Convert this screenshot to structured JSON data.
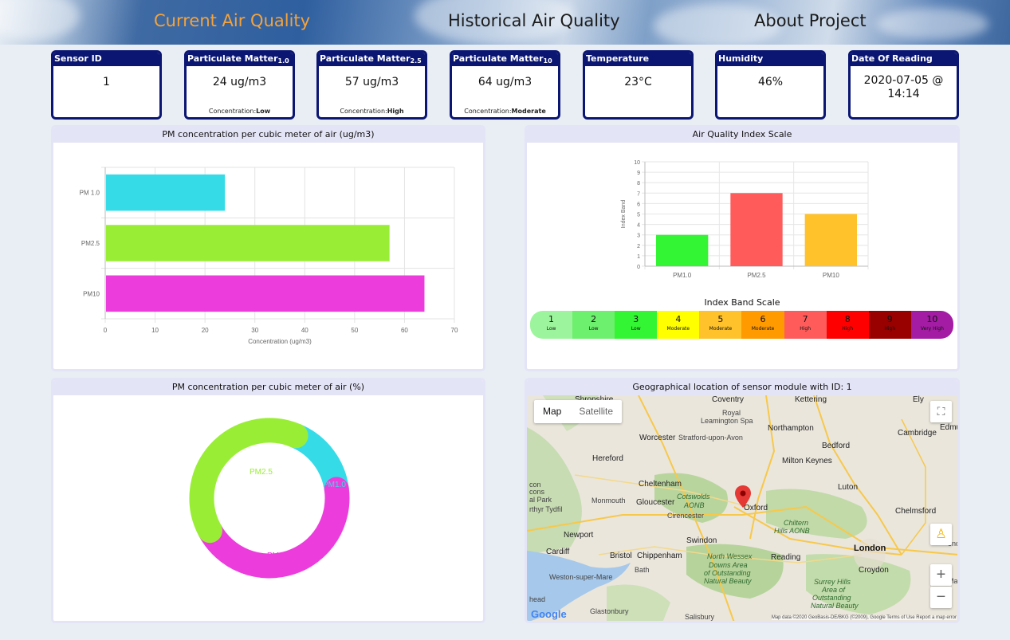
{
  "nav": {
    "items": [
      {
        "label": "Current Air Quality",
        "active": true
      },
      {
        "label": "Historical Air Quality",
        "active": false
      },
      {
        "label": "About Project",
        "active": false
      }
    ]
  },
  "cards": {
    "sensor": {
      "title": "Sensor ID",
      "value": "1"
    },
    "pm1": {
      "title": "Particulate Matter",
      "sub": "1.0",
      "value": "24 ug/m3",
      "conc_label": "Concentration:",
      "conc_value": "Low"
    },
    "pm25": {
      "title": "Particulate Matter",
      "sub": "2.5",
      "value": "57 ug/m3",
      "conc_label": "Concentration:",
      "conc_value": "High"
    },
    "pm10": {
      "title": "Particulate Matter",
      "sub": "10",
      "value": "64 ug/m3",
      "conc_label": "Concentration:",
      "conc_value": "Moderate"
    },
    "temp": {
      "title": "Temperature",
      "value": "23°C"
    },
    "humidity": {
      "title": "Humidity",
      "value": "46%"
    },
    "date": {
      "title": "Date Of Reading",
      "value_line1": "2020-07-05 @",
      "value_line2": "14:14"
    }
  },
  "panels": {
    "bar_title": "PM concentration per cubic meter of air (ug/m3)",
    "aqi_title": "Air Quality Index Scale",
    "donut_title": "PM concentration per cubic meter of air (%)",
    "map_title": "Geographical location of sensor module with ID: 1"
  },
  "chart_data": [
    {
      "type": "bar",
      "orientation": "horizontal",
      "categories": [
        "PM 1.0",
        "PM2.5",
        "PM10"
      ],
      "values": [
        24,
        57,
        64
      ],
      "colors": [
        "#36dbe8",
        "#99ee35",
        "#ec3ddc"
      ],
      "xlabel": "Concentration (ug/m3)",
      "xlim": [
        0,
        70
      ],
      "xticks": [
        0,
        10,
        20,
        30,
        40,
        50,
        60,
        70
      ],
      "grid": true
    },
    {
      "type": "bar",
      "categories": [
        "PM1.0",
        "PM2.5",
        "PM10"
      ],
      "values": [
        3,
        7,
        5
      ],
      "colors": [
        "#33f533",
        "#ff5b5b",
        "#ffc22b"
      ],
      "ylabel": "Index Band",
      "ylim": [
        0,
        10
      ],
      "yticks": [
        0,
        1,
        2,
        3,
        4,
        5,
        6,
        7,
        8,
        9,
        10
      ],
      "grid": true
    },
    {
      "type": "pie",
      "style": "donut",
      "categories": [
        "PM1.0",
        "PM2.5",
        "PM10."
      ],
      "values": [
        24,
        57,
        64
      ],
      "colors": [
        "#36dbe8",
        "#99ee35",
        "#ec3ddc"
      ]
    }
  ],
  "band_scale": {
    "title": "Index Band Scale",
    "bands": [
      {
        "n": "1",
        "label": "Low",
        "color": "#9cf59c"
      },
      {
        "n": "2",
        "label": "Low",
        "color": "#6df06d"
      },
      {
        "n": "3",
        "label": "Low",
        "color": "#33f533"
      },
      {
        "n": "4",
        "label": "Moderate",
        "color": "#ffff00"
      },
      {
        "n": "5",
        "label": "Moderate",
        "color": "#ffc22b"
      },
      {
        "n": "6",
        "label": "Moderate",
        "color": "#ff9a00"
      },
      {
        "n": "7",
        "label": "High",
        "color": "#ff5b5b"
      },
      {
        "n": "8",
        "label": "High",
        "color": "#ff0000"
      },
      {
        "n": "9",
        "label": "High",
        "color": "#990000"
      },
      {
        "n": "10",
        "label": "Very High",
        "color": "#a31ca3"
      }
    ]
  },
  "map": {
    "toggle_map": "Map",
    "toggle_satellite": "Satellite",
    "fullscreen_icon": "fullscreen-icon",
    "pegman_icon": "pegman-icon",
    "zoom_in": "+",
    "zoom_out": "−",
    "logo": "Google",
    "attribution": "Map data ©2020 GeoBasis-DE/BKG (©2009), Google   Terms of Use   Report a map error",
    "labels": [
      {
        "t": "Shropshire"
      },
      {
        "t": "Coventry"
      },
      {
        "t": "Kettering"
      },
      {
        "t": "Ely"
      },
      {
        "t": "Royal"
      },
      {
        "t": "Leamington Spa"
      },
      {
        "t": "Northampton"
      },
      {
        "t": "Cambridge"
      },
      {
        "t": "Worcester"
      },
      {
        "t": "Stratford-upon-Avon"
      },
      {
        "t": "Edmu"
      },
      {
        "t": "Bedford"
      },
      {
        "t": "Hereford"
      },
      {
        "t": "Milton Keynes"
      },
      {
        "t": "Cheltenham"
      },
      {
        "t": "Luton"
      },
      {
        "t": "Gloucester"
      },
      {
        "t": "Cotswolds"
      },
      {
        "t": "AONB"
      },
      {
        "t": "Oxford"
      },
      {
        "t": "Chelmsford"
      },
      {
        "t": "Monmouth"
      },
      {
        "t": "Cirencester"
      },
      {
        "t": "Chiltern"
      },
      {
        "t": "Hills AONB"
      },
      {
        "t": "Newport"
      },
      {
        "t": "Swindon"
      },
      {
        "t": "London"
      },
      {
        "t": "Cardiff"
      },
      {
        "t": "Bristol"
      },
      {
        "t": "Chippenham"
      },
      {
        "t": "North Wessex"
      },
      {
        "t": "Downs Area"
      },
      {
        "t": "of Outstanding"
      },
      {
        "t": "Natural Beauty"
      },
      {
        "t": "Reading"
      },
      {
        "t": "Bath"
      },
      {
        "t": "Croydon"
      },
      {
        "t": "Weston-super-Mare"
      },
      {
        "t": "Surrey Hills"
      },
      {
        "t": "Area of"
      },
      {
        "t": "Outstanding"
      },
      {
        "t": "Natural Beauty"
      },
      {
        "t": "Glastonbury"
      },
      {
        "t": "Salisbury"
      },
      {
        "t": "con"
      },
      {
        "t": "cons"
      },
      {
        "t": "al Park"
      },
      {
        "t": "rthyr Tydfil"
      },
      {
        "t": "head"
      },
      {
        "t": "S"
      },
      {
        "t": "end"
      },
      {
        "t": "Ma"
      }
    ]
  }
}
